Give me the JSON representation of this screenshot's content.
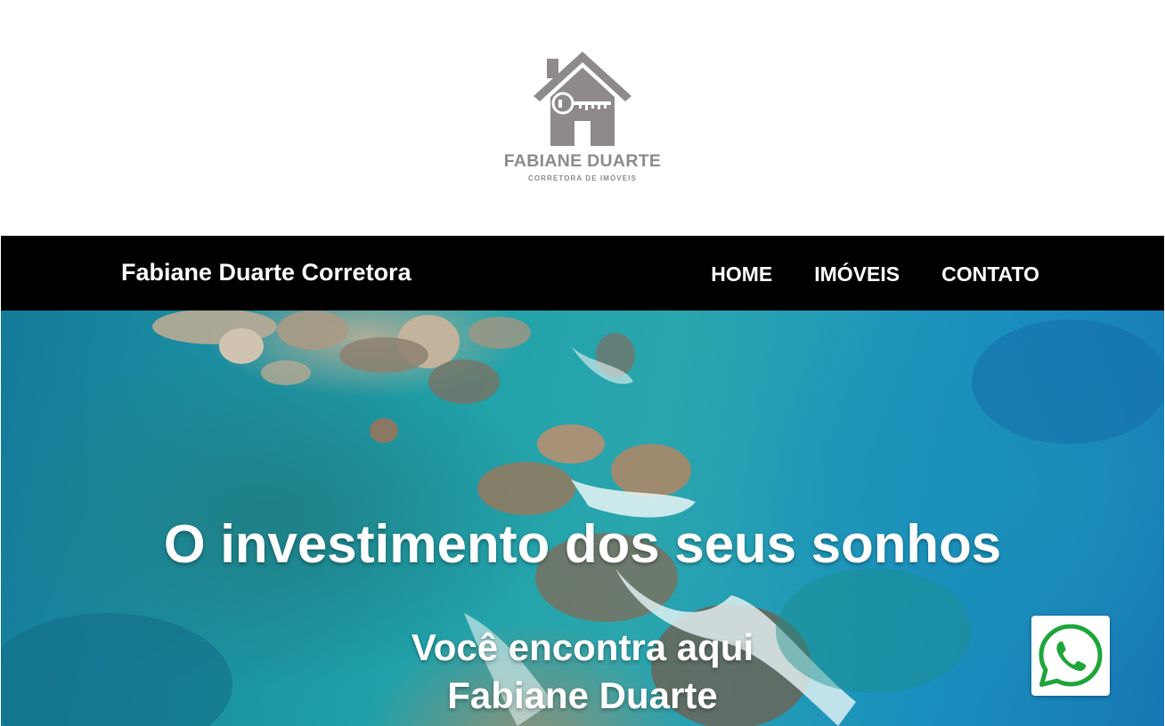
{
  "logo": {
    "name": "FABIANE DUARTE",
    "subtitle": "CORRETORA DE IMÓVEIS",
    "icon": "house-key-icon",
    "color": "#8e8a8b"
  },
  "navbar": {
    "brand": "Fabiane Duarte Corretora",
    "links": [
      "HOME",
      "IMÓVEIS",
      "CONTATO"
    ],
    "background": "#000000"
  },
  "hero": {
    "title": "O investimento dos seus sonhos",
    "subtitle_line1": "Você encontra aqui",
    "subtitle_line2": "Fabiane Duarte"
  },
  "whatsapp": {
    "icon": "whatsapp-icon",
    "color": "#1ea53a"
  }
}
